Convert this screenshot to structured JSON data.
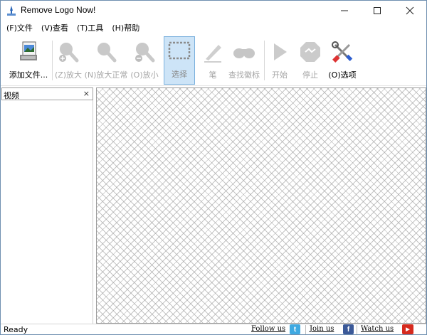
{
  "window": {
    "title": "Remove Logo Now!",
    "minimize_icon": "minimize-icon",
    "maximize_icon": "maximize-icon",
    "close_icon": "close-icon"
  },
  "menu": [
    {
      "label": "(F)文件"
    },
    {
      "label": "(V)查看"
    },
    {
      "label": "(T)工具"
    },
    {
      "label": "(H)帮助"
    }
  ],
  "toolbar": {
    "add_file": "添加文件...",
    "zoom_in": "(Z)放大",
    "zoom_normal": "(N)放大正常",
    "zoom_out": "(O)放小",
    "select": "选择",
    "pen": "笔",
    "find_logo": "查找徽标",
    "start": "开始",
    "stop": "停止",
    "options": "(O)选项"
  },
  "panel": {
    "title": "视频",
    "close": "×"
  },
  "status": {
    "text": "Ready",
    "follow": "Follow us",
    "join": "Join us",
    "watch": "Watch us"
  },
  "colors": {
    "selected_bg": "#cde4f7",
    "twitter": "#3fa9e1",
    "facebook": "#3b5998",
    "youtube": "#d62a1e"
  }
}
